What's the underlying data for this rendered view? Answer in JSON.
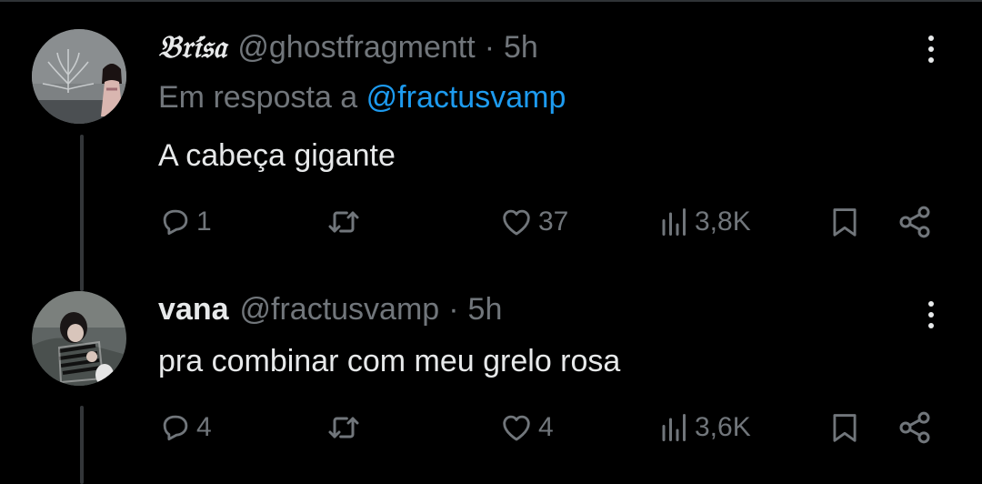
{
  "colors": {
    "background": "#000000",
    "text": "#e7e9ea",
    "secondary": "#71767b",
    "link": "#1d9bf0",
    "thread_line": "#333639"
  },
  "tweets": [
    {
      "display_name": "𝔅𝔯𝔦́𝔰𝔞",
      "handle": "@ghostfragmentt",
      "separator": "·",
      "time": "5h",
      "reply_prefix": "Em resposta a",
      "reply_to": "@fractusvamp",
      "text": "A cabeça gigante",
      "replies": "1",
      "retweets": "",
      "likes": "37",
      "views": "3,8K",
      "icons": [
        "reply-icon",
        "retweet-icon",
        "like-icon",
        "views-icon",
        "bookmark-icon",
        "share-icon",
        "more-icon"
      ]
    },
    {
      "display_name": "vana",
      "handle": "@fractusvamp",
      "separator": "·",
      "time": "5h",
      "text": "pra combinar com meu grelo rosa",
      "replies": "4",
      "retweets": "",
      "likes": "4",
      "views": "3,6K",
      "icons": [
        "reply-icon",
        "retweet-icon",
        "like-icon",
        "views-icon",
        "bookmark-icon",
        "share-icon",
        "more-icon"
      ]
    }
  ]
}
